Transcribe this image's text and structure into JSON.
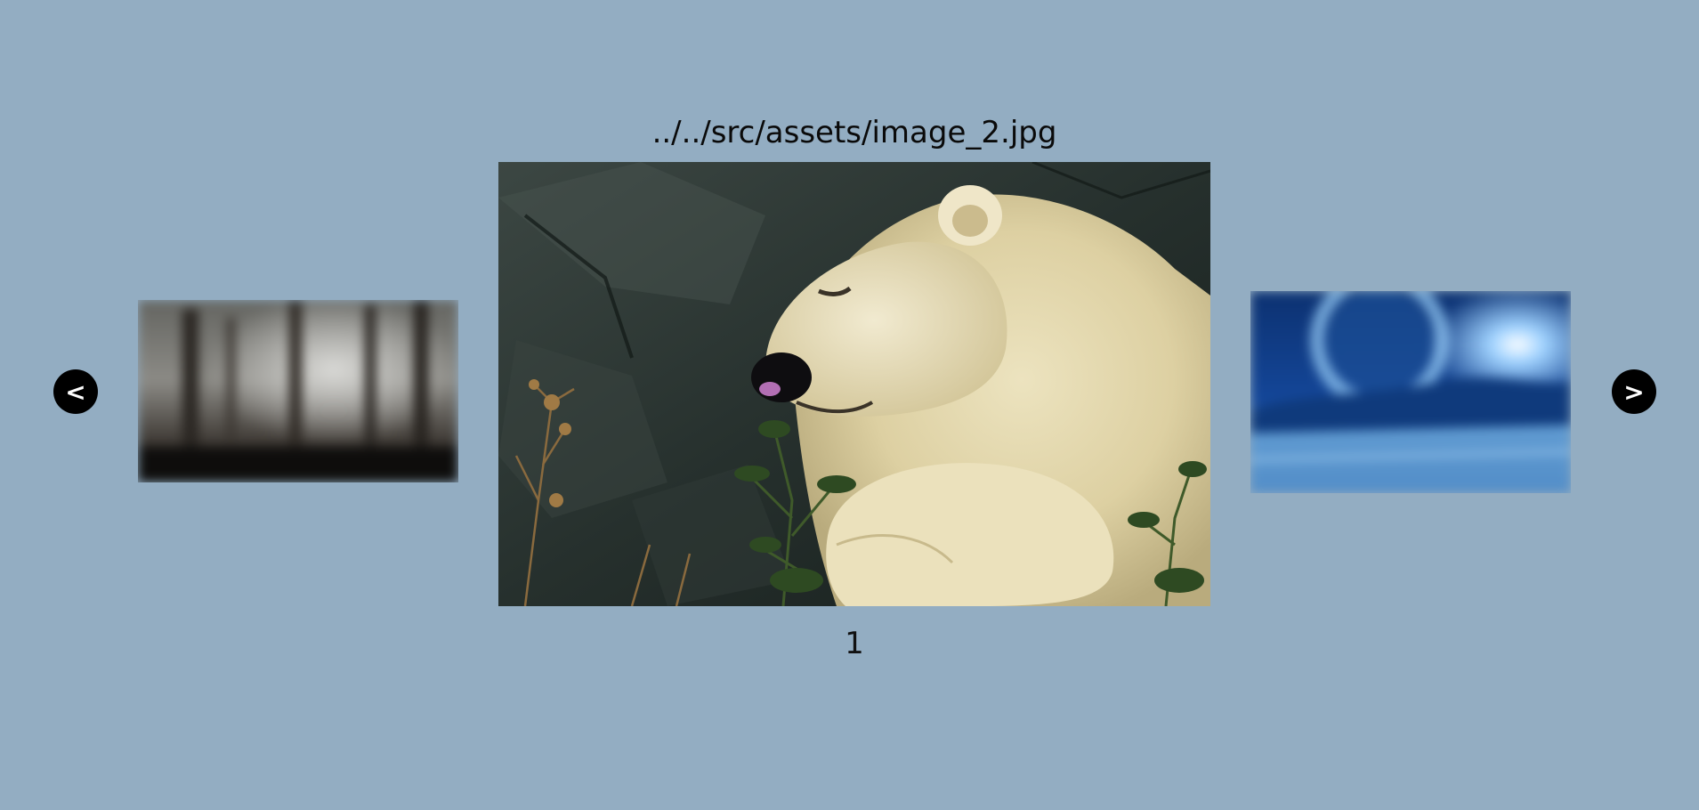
{
  "carousel": {
    "current_image_path": "../../src/assets/image_2.jpg",
    "counter": "1",
    "prev_label": "<",
    "next_label": ">",
    "main_image_icon": "polar-bear-photo",
    "left_thumb_icon": "forest-photo",
    "right_thumb_icon": "blue-planet-landscape-photo"
  },
  "colors": {
    "background": "#93adc2",
    "button": "#000000",
    "button_text": "#ffffff"
  }
}
